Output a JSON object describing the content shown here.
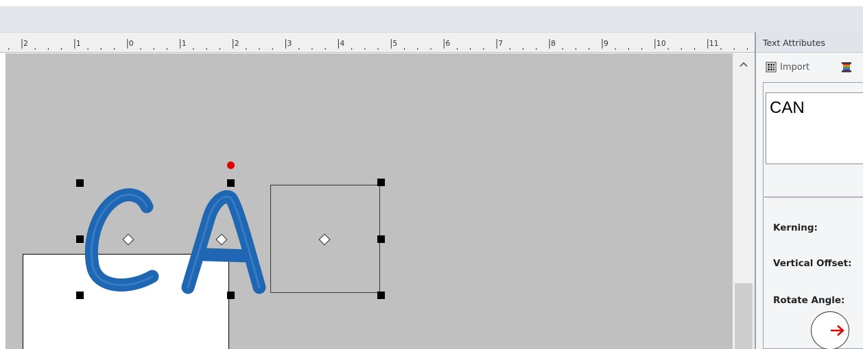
{
  "ruler": {
    "labels": [
      "2",
      "1",
      "0",
      "1",
      "2",
      "3",
      "4",
      "5",
      "6",
      "7",
      "8",
      "9",
      "10",
      "11"
    ]
  },
  "canvas": {
    "background": "#c0c0c0",
    "embroidery_text": "CA",
    "thread_color": "#1f66b3"
  },
  "panel": {
    "title": "Text Attributes",
    "import_label": "Import",
    "text_value": "CAN",
    "kerning_label": "Kerning:",
    "vertical_offset_label": "Vertical Offset:",
    "rotate_angle_label": "Rotate Angle:"
  },
  "icons": [
    "import-icon",
    "thread-spool-icon",
    "scroll-up-icon",
    "rotate-arrow-icon"
  ]
}
